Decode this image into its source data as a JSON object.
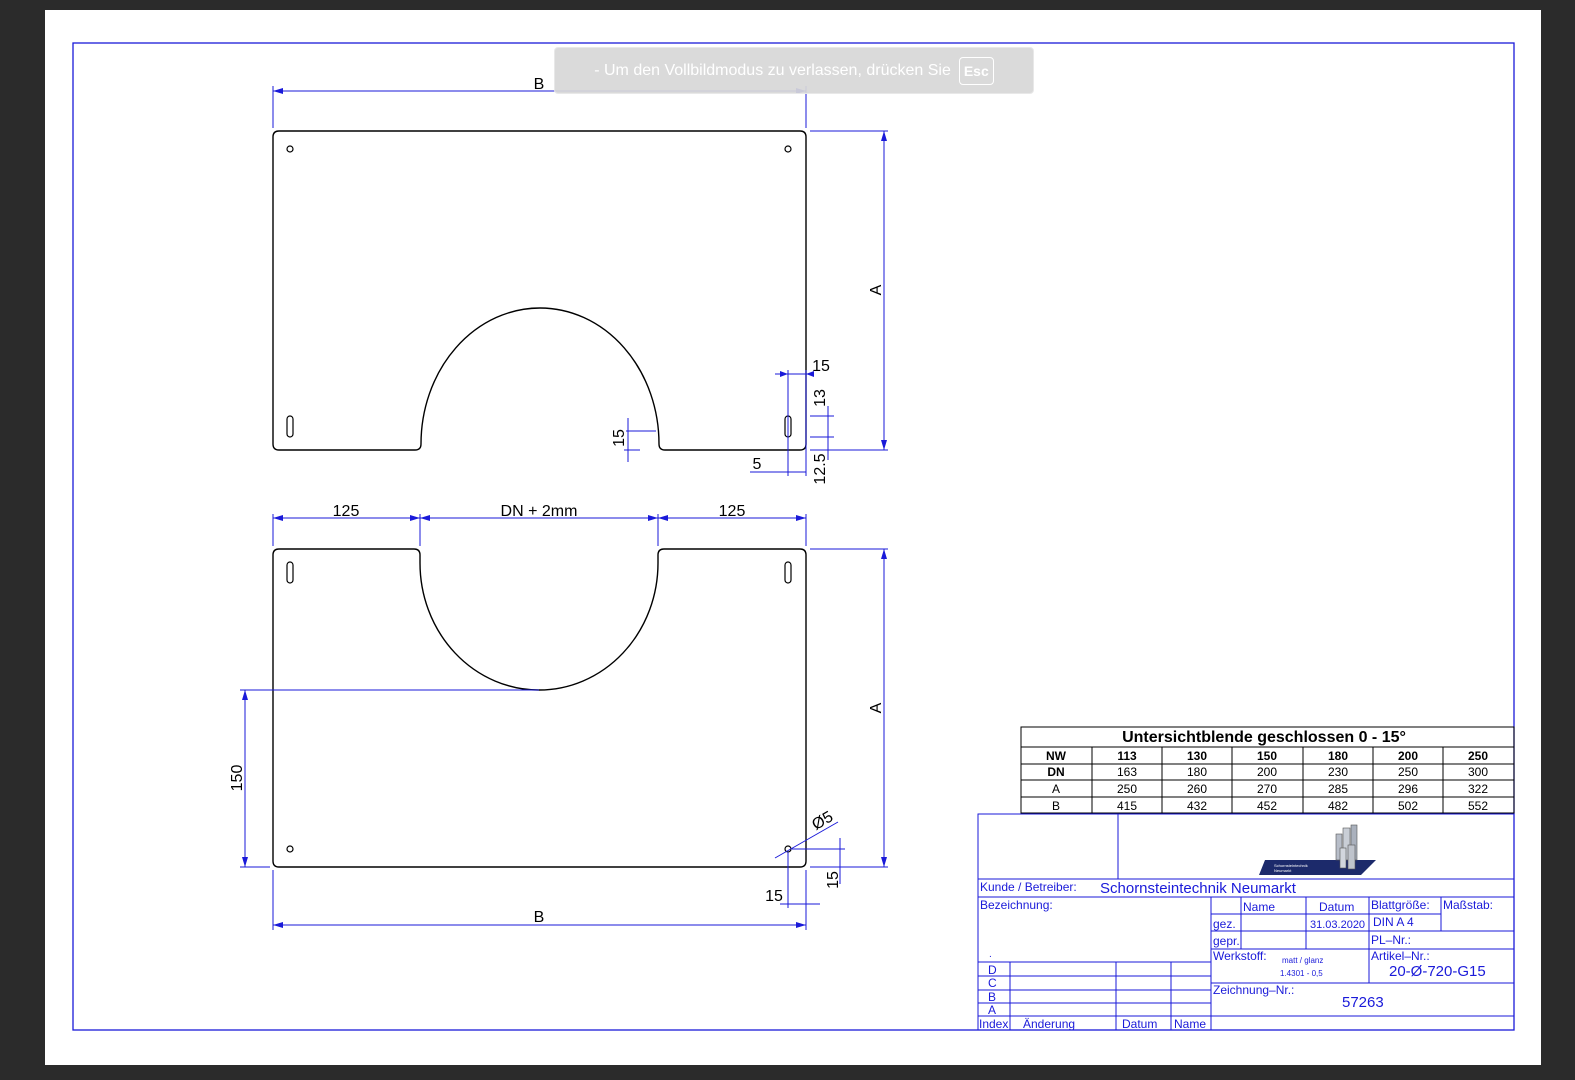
{
  "banner": {
    "text": "-  Um den Vollbildmodus zu verlassen, drücken Sie",
    "key": "Esc"
  },
  "views": {
    "top": {
      "dim_B": "B",
      "dim_A": "A",
      "dim_15_right": "15",
      "dim_13": "13",
      "dim_15_left": "15",
      "dim_5": "5",
      "dim_12_5": "12.5"
    },
    "bottom": {
      "dim_125_left": "125",
      "dim_dn": "DN + 2mm",
      "dim_125_right": "125",
      "dim_A": "A",
      "dim_150": "150",
      "dim_hole": "Ø5",
      "dim_15_v": "15",
      "dim_15_h": "15",
      "dim_B": "B"
    }
  },
  "spec_table": {
    "title": "Untersichtblende geschlossen 0 - 15°",
    "header": [
      "NW",
      "113",
      "130",
      "150",
      "180",
      "200",
      "250"
    ],
    "rows": [
      [
        "DN",
        "163",
        "180",
        "200",
        "230",
        "250",
        "300"
      ],
      [
        "A",
        "250",
        "260",
        "270",
        "285",
        "296",
        "322"
      ],
      [
        "B",
        "415",
        "432",
        "452",
        "482",
        "502",
        "552"
      ]
    ]
  },
  "logo": {
    "line1": "Schornsteintechnik",
    "line2": "Neumarkt"
  },
  "title_block": {
    "kunde_label": "Kunde  /  Betreiber:",
    "kunde_value": "Schornsteintechnik Neumarkt",
    "bezeichnung_label": "Bezeichnung:",
    "dot": ".",
    "name_header": "Name",
    "datum_header": "Datum",
    "blattgroesse_label": "Blattgröße:",
    "massstab_label": "Maßstab:",
    "gez_label": "gez.",
    "gez_datum": "31.03.2020",
    "blattgroesse_value": "DIN  A  4",
    "gepr_label": "gepr.",
    "pl_label": "PL–Nr.:",
    "werkstoff_label": "Werkstoff:",
    "werkstoff_line1": "matt / glanz",
    "werkstoff_line2": "1.4301 - 0,5",
    "artikel_label": "Artikel–Nr.:",
    "artikel_value": "20-Ø-720-G15",
    "zeichnung_label": "Zeichnung–Nr.:",
    "zeichnung_value": "57263",
    "revisions": [
      "D",
      "C",
      "B",
      "A"
    ],
    "footer": {
      "index": "Index",
      "aenderung": "Änderung",
      "datum": "Datum",
      "name": "Name"
    }
  },
  "colors": {
    "dimension": "#1a1ad9",
    "outline": "#000000",
    "background": "#2b2b2b"
  }
}
